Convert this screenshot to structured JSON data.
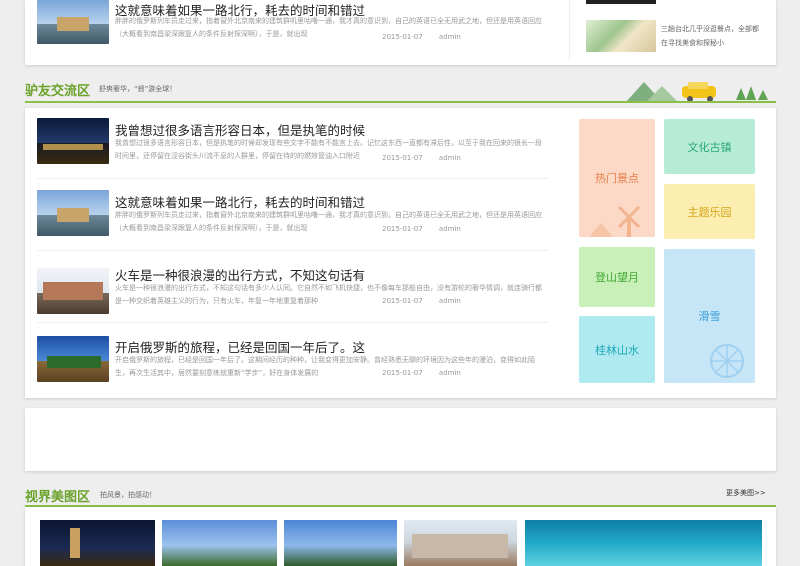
{
  "top_article": {
    "title": "这就意味着如果一路北行，耗去的时间和错过",
    "desc": "胖胖的俄罗斯列车员走过来，指着窗外北京南来的建筑群叽里咕噜一通，我才真的意识到，自己的英语已全无用武之地，但还是用英语回应（大概看到南昌梁深跟复人的条件反射探深啊），于是，就出现",
    "date": "2015-01-07",
    "author": "admin"
  },
  "side_top": {
    "text": "三趟台北几乎没逛餐点，全部都在寻找美食和探秘小"
  },
  "forum": {
    "title": "驴友交流区",
    "subtitle": "舒爽奢华，“蚓”游全球！",
    "articles": [
      {
        "title": "我曾想过很多语言形容日本，但是执笔的时候",
        "desc": "我曾想过很多语言形容日本，但是执笔的时候却发现有些文字不能有不能言上去。记忆这东西一直都有滞后性，以至于我在回来的很长一段时间里，还停留在涩谷街头川流不息的人群里，停留在待的的燃效管油入口附近",
        "date": "2015-01-07",
        "author": "admin"
      },
      {
        "title": "这就意味着如果一路北行，耗去的时间和错过",
        "desc": "胖胖的俄罗斯列车员走过来，指着窗外北京南来的建筑群叽里咕噜一通，我才真的意识到，自己的英语已全无用武之地，但还是用英语回应（大概看到南昌梁深跟复人的条件反射探深啊），于是，就出现",
        "date": "2015-01-07",
        "author": "admin"
      },
      {
        "title": "火车是一种很浪漫的出行方式，不知这句话有",
        "desc": "火车是一种很浪漫的出行方式，不知这句话有多少人认同。它自然不如飞机快捷，也不像每车那般自由，没有游轮的奢华情调，就连骑行都是一种交织着英雄主义的行为，只有火车，年复一年地重复着那种",
        "date": "2015-01-07",
        "author": "admin"
      },
      {
        "title": "开启俄罗斯的旅程，已经是回国一年后了。这",
        "desc": "开启俄罗斯的旅程，已经是回国一年后了。这期间经历的种种，让我变得更加安静。曾经熟悉无聊的环境因为这些年的漫泊，变得如此陌生，再次生活其中，居然要刻意练就重新“学步”，好在身体发展的",
        "date": "2015-01-07",
        "author": "admin"
      }
    ],
    "tiles": {
      "hot_spots": "热门景点",
      "ancient_town": "文化古镇",
      "theme_park": "主题乐园",
      "mountain": "登山望月",
      "ski": "滑雪",
      "guilin": "桂林山水"
    }
  },
  "gallery": {
    "title": "视界美图区",
    "subtitle": "拍风景，拍感动！",
    "more": "更多美图>>"
  },
  "colors": {
    "accent_green": "#6aa22a",
    "tile_peach": "#fbd9c6",
    "tile_mint": "#b6ecd6",
    "tile_yellow": "#fbeeb0",
    "tile_lightgreen": "#c8f0b8",
    "tile_blue": "#c6e6f8",
    "tile_cyan": "#aeeaf0"
  }
}
